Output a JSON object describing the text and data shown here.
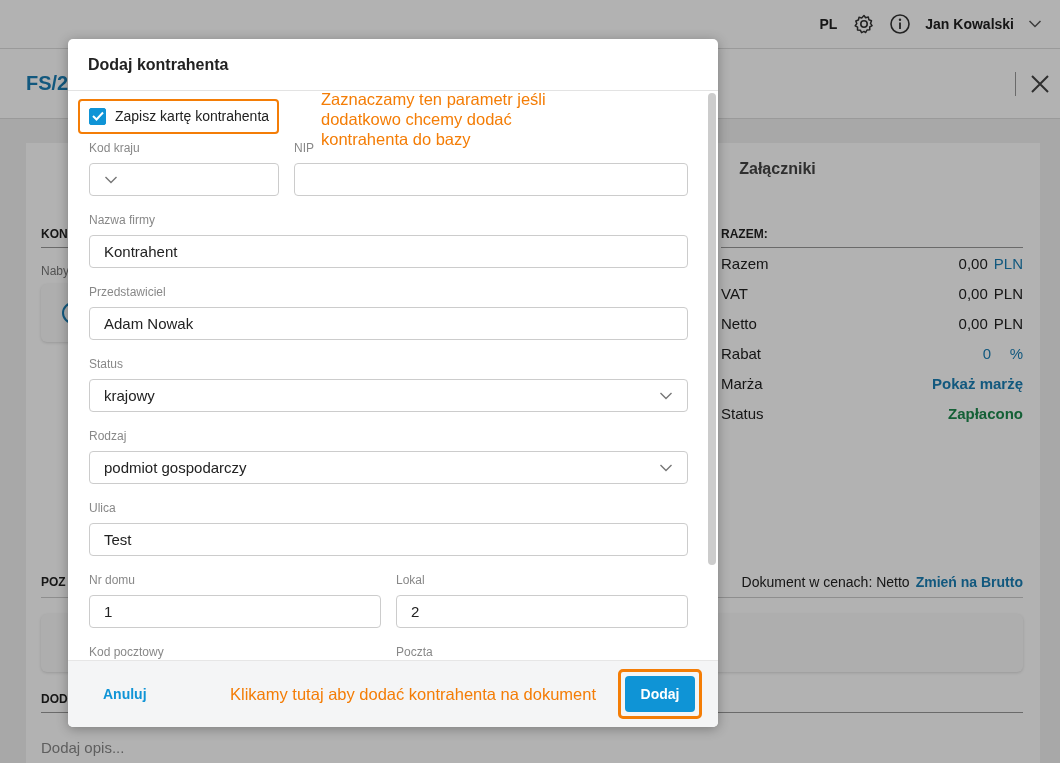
{
  "topbar": {
    "language": "PL",
    "user": "Jan Kowalski"
  },
  "document": {
    "title": "FS/2",
    "tab": "Załączniki"
  },
  "contractor_section": {
    "heading": "KON",
    "label": "Naby"
  },
  "summary": {
    "heading": "RAZEM:",
    "rows": [
      {
        "label": "Razem",
        "value": "0,00",
        "unit": "PLN",
        "kind": "total"
      },
      {
        "label": "VAT",
        "value": "0,00",
        "unit": "PLN",
        "kind": "amount"
      },
      {
        "label": "Netto",
        "value": "0,00",
        "unit": "PLN",
        "kind": "amount"
      },
      {
        "label": "Rabat",
        "value": "0",
        "unit": "%",
        "kind": "discount"
      },
      {
        "label": "Marża",
        "value": "Pokaż marżę",
        "kind": "link"
      },
      {
        "label": "Status",
        "value": "Zapłacono",
        "kind": "status"
      }
    ]
  },
  "price_mode": {
    "text": "Dokument w cenach: Netto",
    "link": "Zmień na Brutto"
  },
  "items_section": {
    "heading": "POZ"
  },
  "description_section": {
    "heading": "DOD",
    "placeholder": "Dodaj opis..."
  },
  "dialog": {
    "title": "Dodaj kontrahenta",
    "save_card": {
      "label": "Zapisz kartę kontrahenta",
      "checked": true,
      "highlighted": true,
      "annotation": "Zaznaczamy ten parametr jeśli dodatkowo chcemy dodać kontrahenta do bazy"
    },
    "field_rows": [
      {
        "kind": "narrow_wide",
        "fields": [
          {
            "label": "Kod kraju",
            "kind": "select"
          },
          {
            "label": "NIP",
            "kind": "text"
          }
        ]
      },
      {
        "kind": "full",
        "fields": [
          {
            "label": "Nazwa firmy",
            "kind": "text",
            "value": "Kontrahent"
          }
        ]
      },
      {
        "kind": "full",
        "fields": [
          {
            "label": "Przedstawiciel",
            "kind": "text",
            "value": "Adam Nowak"
          }
        ]
      },
      {
        "kind": "full",
        "fields": [
          {
            "label": "Status",
            "kind": "select",
            "value": "krajowy"
          }
        ]
      },
      {
        "kind": "full",
        "fields": [
          {
            "label": "Rodzaj",
            "kind": "select",
            "value": "podmiot gospodarczy"
          }
        ]
      },
      {
        "kind": "full",
        "fields": [
          {
            "label": "Ulica",
            "kind": "text",
            "value": "Test"
          }
        ]
      },
      {
        "kind": "halves",
        "fields": [
          {
            "label": "Nr domu",
            "kind": "text",
            "value": "1"
          },
          {
            "label": "Lokal",
            "kind": "text",
            "value": "2"
          }
        ]
      },
      {
        "kind": "halves",
        "fields": [
          {
            "label": "Kod pocztowy",
            "kind": "label"
          },
          {
            "label": "Poczta",
            "kind": "label"
          }
        ]
      }
    ],
    "cancel": "Anuluj",
    "confirm": {
      "label": "Dodaj",
      "highlighted": true,
      "annotation": "Klikamy tutaj aby dodać kontrahenta na dokument"
    }
  }
}
